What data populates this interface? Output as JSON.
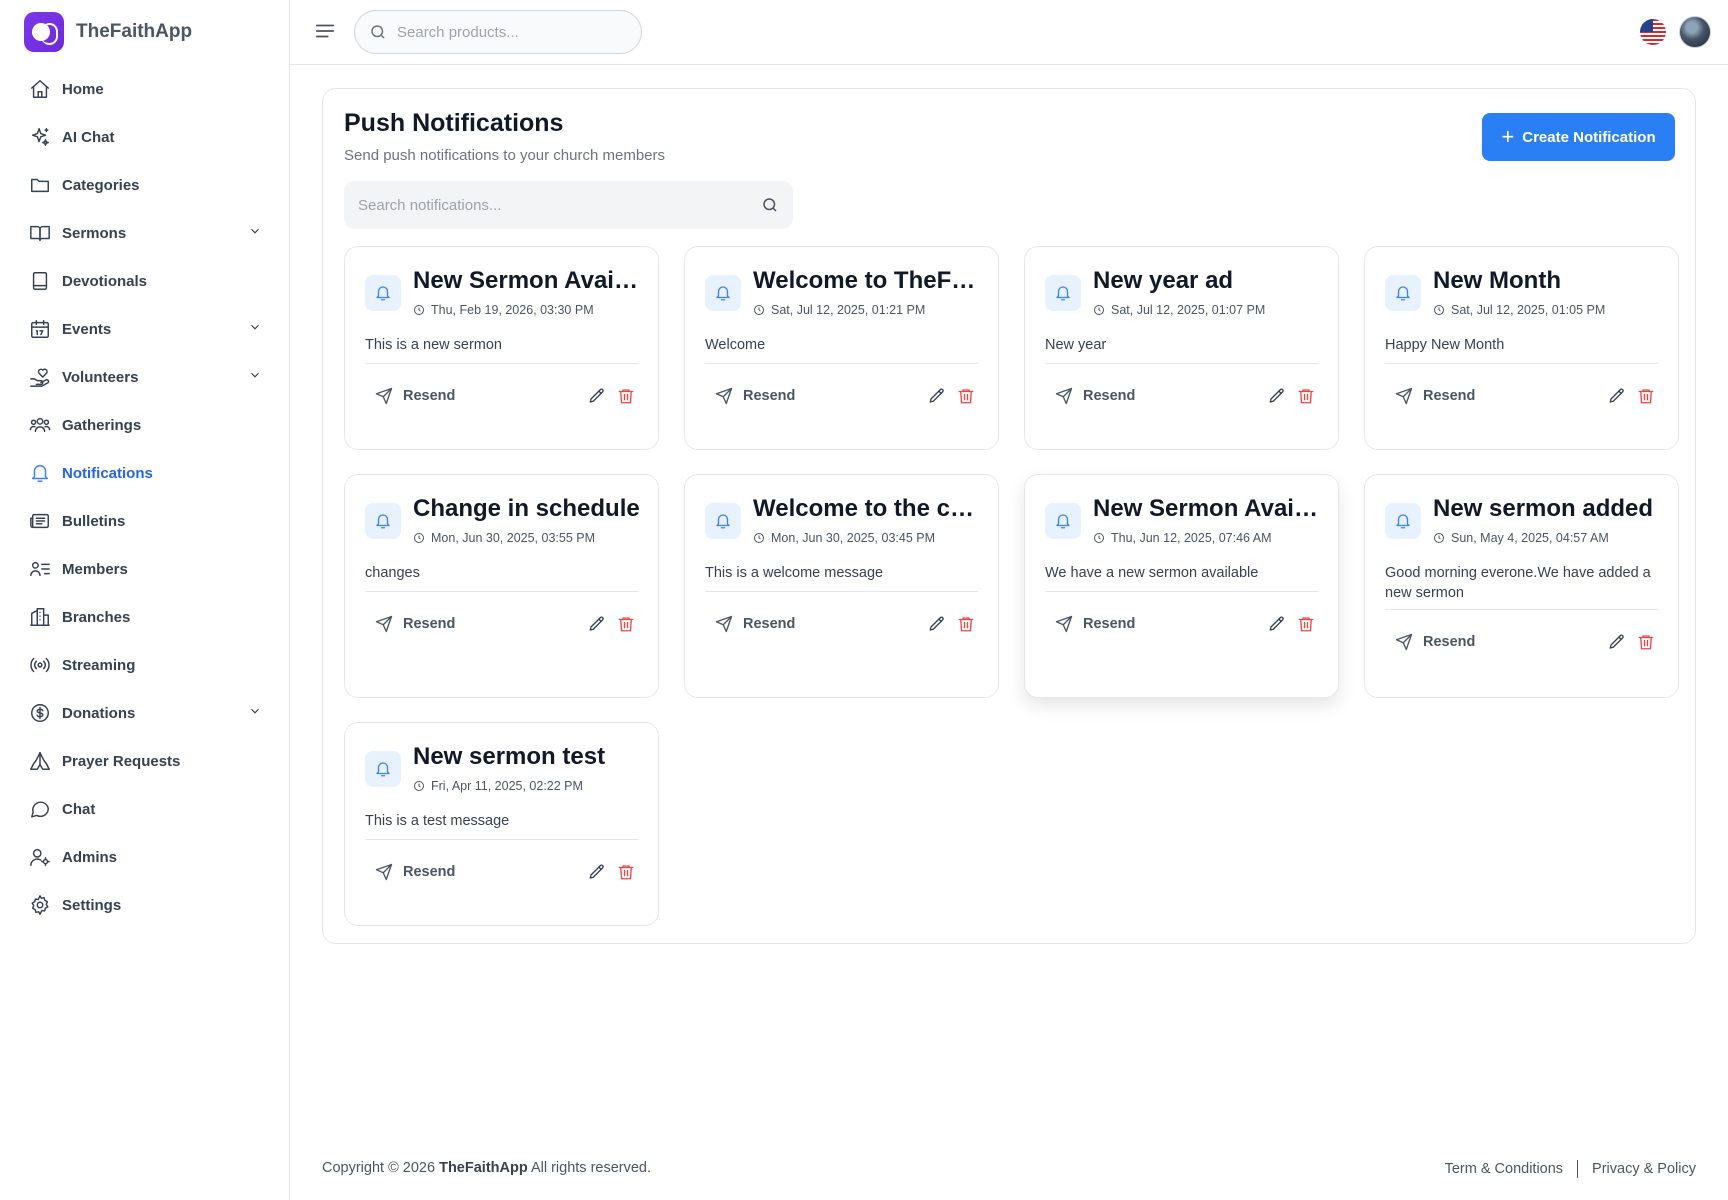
{
  "brand": {
    "name": "TheFaithApp"
  },
  "sidebar": {
    "items": [
      {
        "label": "Home",
        "icon": "home-icon"
      },
      {
        "label": "AI Chat",
        "icon": "sparkle-icon"
      },
      {
        "label": "Categories",
        "icon": "folder-icon"
      },
      {
        "label": "Sermons",
        "icon": "book-icon",
        "expandable": true
      },
      {
        "label": "Devotionals",
        "icon": "notebook-icon"
      },
      {
        "label": "Events",
        "icon": "calendar-icon",
        "expandable": true
      },
      {
        "label": "Volunteers",
        "icon": "hand-heart-icon",
        "expandable": true
      },
      {
        "label": "Gatherings",
        "icon": "group-icon"
      },
      {
        "label": "Notifications",
        "icon": "bell-icon",
        "active": true
      },
      {
        "label": "Bulletins",
        "icon": "newspaper-icon"
      },
      {
        "label": "Members",
        "icon": "members-list-icon"
      },
      {
        "label": "Branches",
        "icon": "building-icon"
      },
      {
        "label": "Streaming",
        "icon": "broadcast-icon"
      },
      {
        "label": "Donations",
        "icon": "dollar-circle-icon",
        "expandable": true
      },
      {
        "label": "Prayer Requests",
        "icon": "praying-hands-icon"
      },
      {
        "label": "Chat",
        "icon": "chat-bubble-icon"
      },
      {
        "label": "Admins",
        "icon": "user-cog-icon"
      },
      {
        "label": "Settings",
        "icon": "gear-icon"
      }
    ]
  },
  "topbar": {
    "search_placeholder": "Search products..."
  },
  "page": {
    "title": "Push Notifications",
    "subtitle": "Send push notifications to your church members",
    "create_button": "Create Notification",
    "search_placeholder": "Search notifications...",
    "accent_color": "#2b7ff5"
  },
  "notifications": [
    {
      "title": "New Sermon Available",
      "date": "Thu, Feb 19, 2026, 03:30 PM",
      "message": "This is a new sermon",
      "resend": "Resend"
    },
    {
      "title": "Welcome to TheFaithApp",
      "date": "Sat, Jul 12, 2025, 01:21 PM",
      "message": "Welcome",
      "resend": "Resend"
    },
    {
      "title": "New year ad",
      "date": "Sat, Jul 12, 2025, 01:07 PM",
      "message": "New year",
      "resend": "Resend"
    },
    {
      "title": "New Month",
      "date": "Sat, Jul 12, 2025, 01:05 PM",
      "message": "Happy New Month",
      "resend": "Resend"
    },
    {
      "title": "Change in schedule",
      "date": "Mon, Jun 30, 2025, 03:55 PM",
      "message": "changes",
      "resend": "Resend"
    },
    {
      "title": "Welcome to the church",
      "date": "Mon, Jun 30, 2025, 03:45 PM",
      "message": "This is a welcome message",
      "resend": "Resend"
    },
    {
      "title": "New Sermon Available",
      "date": "Thu, Jun 12, 2025, 07:46 AM",
      "message": "We have a new sermon available",
      "resend": "Resend"
    },
    {
      "title": "New sermon added",
      "date": "Sun, May 4, 2025, 04:57 AM",
      "message": "Good morning everone.We have added a new sermon",
      "resend": "Resend"
    },
    {
      "title": "New sermon test",
      "date": "Fri, Apr 11, 2025, 02:22 PM",
      "message": "This is a test message",
      "resend": "Resend"
    }
  ],
  "footer": {
    "copyright_prefix": "Copyright © 2026",
    "brand": "TheFaithApp",
    "copyright_suffix": "All rights reserved.",
    "terms": "Term & Conditions",
    "privacy": "Privacy & Policy"
  }
}
